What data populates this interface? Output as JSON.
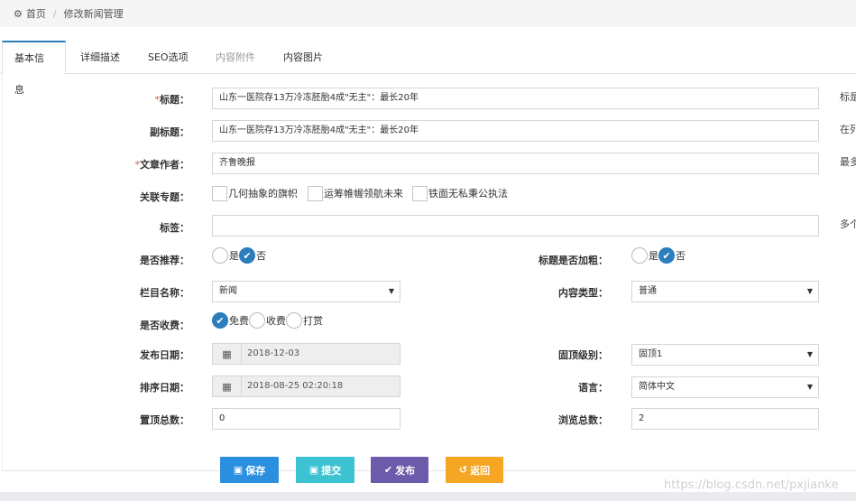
{
  "breadcrumb": {
    "home": "首页",
    "current": "修改新闻管理"
  },
  "tabs": [
    {
      "label": "基本信息"
    },
    {
      "label": "详细描述"
    },
    {
      "label": "SEO选项"
    },
    {
      "label": "内容附件"
    },
    {
      "label": "内容图片"
    }
  ],
  "form": {
    "title": {
      "label": "标题：",
      "value": "山东一医院存13万冷冻胚胎4成\"无主\"：最长20年",
      "hint": "标是"
    },
    "subtitle": {
      "label": "副标题：",
      "value": "山东一医院存13万冷冻胚胎4成\"无主\"：最长20年",
      "hint": "在列"
    },
    "author": {
      "label": "文章作者：",
      "value": "齐鲁晚报",
      "hint": "最多"
    },
    "topics": {
      "label": "关联专题：",
      "options": [
        "几何抽象的旗帜",
        "运筹帷幄领航未来",
        "铁面无私秉公执法"
      ]
    },
    "tags": {
      "label": "标签：",
      "value": "",
      "hint": "多个"
    },
    "recommend": {
      "label": "是否推荐：",
      "options": [
        "是",
        "否"
      ],
      "selected": "否"
    },
    "bold": {
      "label": "标题是否加粗：",
      "options": [
        "是",
        "否"
      ],
      "selected": "否"
    },
    "column": {
      "label": "栏目名称：",
      "value": "新闻"
    },
    "content_type": {
      "label": "内容类型：",
      "value": "普通"
    },
    "fee": {
      "label": "是否收费：",
      "options": [
        "免费",
        "收费",
        "打赏"
      ],
      "selected": "免费"
    },
    "publish_date": {
      "label": "发布日期：",
      "value": "2018-12-03"
    },
    "pin_level": {
      "label": "固顶级别：",
      "value": "固顶1"
    },
    "sort_date": {
      "label": "排序日期：",
      "value": "2018-08-25 02:20:18"
    },
    "language": {
      "label": "语言：",
      "value": "简体中文"
    },
    "top_count": {
      "label": "置顶总数：",
      "value": "0"
    },
    "view_count": {
      "label": "浏览总数：",
      "value": "2"
    }
  },
  "buttons": {
    "save": "保存",
    "submit": "提交",
    "publish": "发布",
    "back": "返回"
  },
  "watermark": "https://blog.csdn.net/pxjianke",
  "colors": {
    "save": "#2b8fe0",
    "submit": "#3cc3d2",
    "publish": "#6c5aab",
    "back": "#f5a623",
    "accent": "#2b7dbc"
  }
}
